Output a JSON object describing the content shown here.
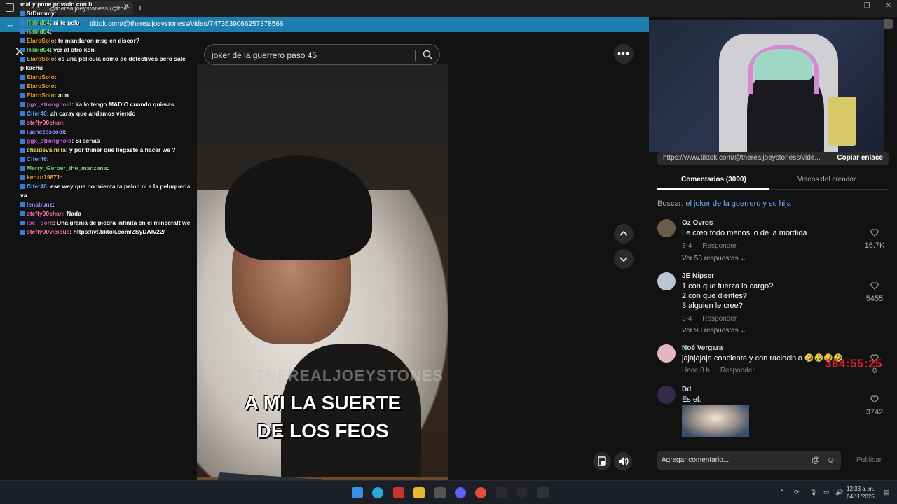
{
  "browser": {
    "tab_title": "@therealjoeystoness (@ther",
    "url": "tiktok.com/@therealjoeystoness/video/7473639066257378566"
  },
  "video": {
    "search_placeholder": "joker de la guerrero paso 45",
    "watermark": "@THEREALJOEYSTONES",
    "caption_line1": "A MI LA SUERTE",
    "caption_line2": "DE LOS FEOS"
  },
  "chat": {
    "lines": [
      {
        "user": "",
        "msg": "mal y pone privado con b",
        "color": "#ffffff"
      },
      {
        "user": "StDummy",
        "msg": "",
        "color": "#ffffff"
      },
      {
        "user": "Habid04",
        "msg": "ni te pelo",
        "color": "#7bd36b"
      },
      {
        "user": "Habid04",
        "msg": "",
        "color": "#7bd36b"
      },
      {
        "user": "ElaroSolo",
        "msg": "te mandaron msg en discor?",
        "color": "#f0a030"
      },
      {
        "user": "Habid04",
        "msg": "ver al otro kon",
        "color": "#7bd36b"
      },
      {
        "user": "ElaroSolo",
        "msg": "es una pelicula como de detectives pero sale pikachu",
        "color": "#f0a030"
      },
      {
        "user": "ElaroSolo",
        "msg": "",
        "color": "#f0a030"
      },
      {
        "user": "ElaroSolo",
        "msg": "",
        "color": "#f0a030"
      },
      {
        "user": "ElaroSolo",
        "msg": "aun",
        "color": "#f0a030"
      },
      {
        "user": "ggx_stronghold",
        "msg": "Ya lo tengo MADIO cuando quieras",
        "color": "#c56bd6"
      },
      {
        "user": "Cifer46",
        "msg": "ah caray que andamos viendo",
        "color": "#6aa8ff"
      },
      {
        "user": "steffy00chan",
        "msg": "",
        "color": "#ff7bb0"
      },
      {
        "user": "luanezescool",
        "msg": "",
        "color": "#9b8cff"
      },
      {
        "user": "ggx_stronghold",
        "msg": "Si serias",
        "color": "#c56bd6"
      },
      {
        "user": "chaidevainilla",
        "msg": "y por thiner que llegaste a hacer we ?",
        "color": "#f0e06a"
      },
      {
        "user": "Cifer46",
        "msg": "",
        "color": "#6aa8ff"
      },
      {
        "user": "Merry_Gerber_the_manzana",
        "msg": "",
        "color": "#7bd36b"
      },
      {
        "user": "kenzo19871",
        "msg": "",
        "color": "#f0a030"
      },
      {
        "user": "Cifer46",
        "msg": "ese wey que no mienta ta pelon ni a la peluqueria va",
        "color": "#6aa8ff"
      },
      {
        "user": "lenabunz",
        "msg": "",
        "color": "#9b8cff"
      },
      {
        "user": "steffy00chan",
        "msg": "Nada",
        "color": "#ff7bb0"
      },
      {
        "user": "joel_dore",
        "msg": "Una granja de piedra infinita en el minecraft we",
        "color": "#d04fc0"
      },
      {
        "user": "steffy00vicious",
        "msg": "https://vt.tiktok.com/ZSyDAfv22/",
        "color": "#ff7bb0"
      }
    ]
  },
  "panel": {
    "share_url": "https://www.tiktok.com/@therealjoeystoness/vide...",
    "copy_link": "Copiar enlace",
    "tab_comments": "Comentarios (3090)",
    "tab_videos": "Videos del creador",
    "search_prefix": "Buscar: ",
    "search_query": "el joker de la guerrero y su hija",
    "comments": [
      {
        "author": "Oz Ovros",
        "text": "Le creo todo menos lo de la mordida",
        "date": "3-4",
        "reply": "Responder",
        "replies": "Ver 53 respuestas",
        "likes": "15.7K"
      },
      {
        "author": "JE Nipser",
        "text": "1 con que fuerza lo cargo?\n2 con que dientes?\n3 alguien le cree?",
        "date": "3-4",
        "reply": "Responder",
        "replies": "Ver 93 respuestas",
        "likes": "5455"
      },
      {
        "author": "Noé Vergara",
        "text": "jajajajaja conciente y con raciocinio 🤣🤣🤣🤣",
        "date": "Hace 8 h",
        "reply": "Responder",
        "replies": "",
        "likes": "0"
      },
      {
        "author": "Dd",
        "text": "Es el:",
        "date": "",
        "reply": "",
        "replies": "",
        "likes": "3742"
      }
    ],
    "add_comment_placeholder": "Agregar comentario...",
    "publish": "Publicar"
  },
  "overlay": {
    "timer": "384:55:25"
  },
  "taskbar": {
    "time": "12:33 a. m.",
    "date": "04/11/2025"
  }
}
